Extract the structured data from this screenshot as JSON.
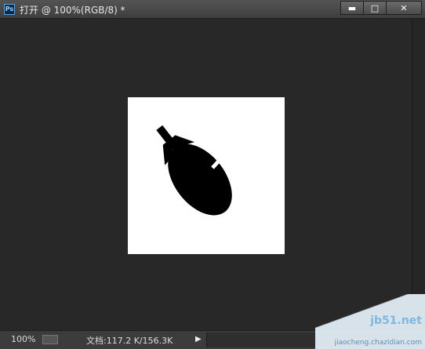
{
  "window": {
    "title": "打开 @ 100%(RGB/8) *",
    "app_icon_label": "Ps",
    "minimize_glyph": "▬",
    "maximize_glyph": "□",
    "close_glyph": "✕"
  },
  "status": {
    "zoom": "100%",
    "doc_info": "文档:117.2 K/156.3K",
    "arrow_glyph": "▶"
  },
  "watermark": {
    "line1": "jb51.net",
    "line2": "jiaocheng.chazidian.com"
  },
  "colors": {
    "workspace": "#282828",
    "document": "#ffffff",
    "icon": "#000000"
  },
  "icons": {
    "document_content": "eggplant-icon"
  }
}
